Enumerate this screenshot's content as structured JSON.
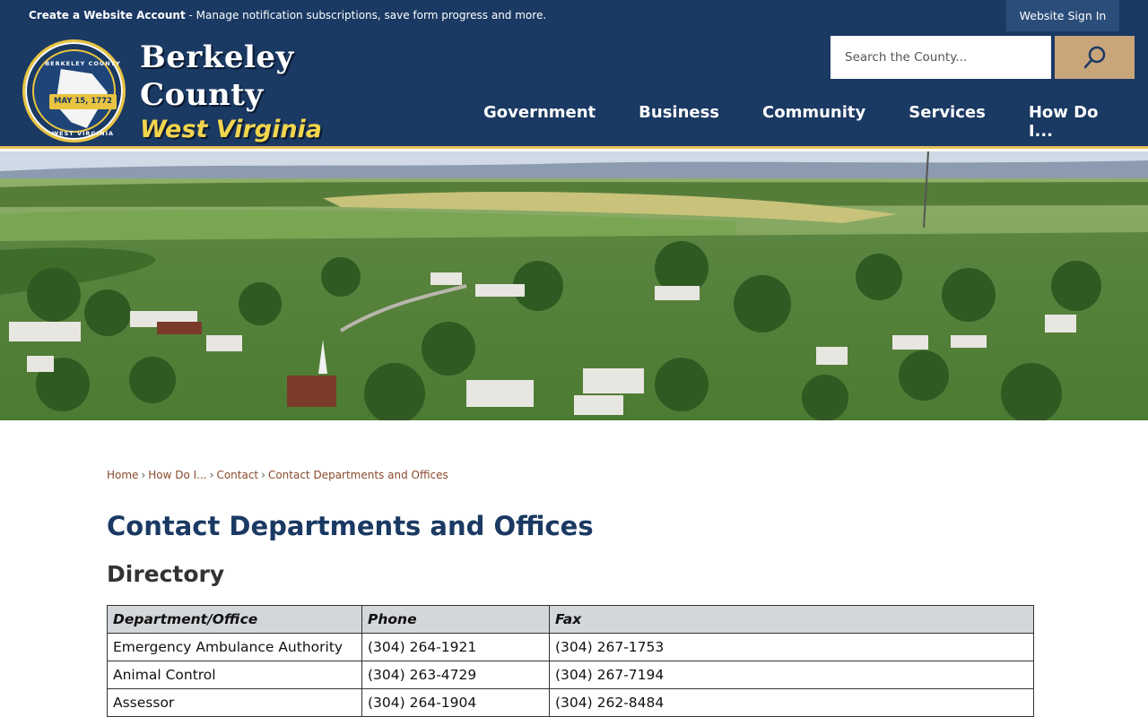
{
  "topbar": {
    "account_link": "Create a Website Account",
    "account_desc": " - Manage notification subscriptions, save form progress and more.",
    "signin": "Website Sign In"
  },
  "header": {
    "seal": {
      "top_text": "BERKELEY COUNTY",
      "date": "MAY 15, 1772",
      "bottom_text": "WEST VIRGINIA"
    },
    "brand_line1": "Berkeley",
    "brand_line2": "County",
    "brand_line3": "West Virginia",
    "search_placeholder": "Search the County...",
    "nav": [
      "Government",
      "Business",
      "Community",
      "Services",
      "How Do I..."
    ]
  },
  "breadcrumb": [
    "Home",
    "How Do I...",
    "Contact",
    "Contact Departments and Offices"
  ],
  "page_title": "Contact Departments and Offices",
  "section_title": "Directory",
  "table": {
    "headers": [
      "Department/Office",
      "Phone",
      "Fax"
    ],
    "rows": [
      [
        "Emergency Ambulance Authority",
        "(304) 264-1921",
        "(304) 267-1753"
      ],
      [
        "Animal Control",
        "(304) 263-4729",
        "(304) 267-7194"
      ],
      [
        "Assessor",
        "(304) 264-1904",
        "(304) 262-8484"
      ]
    ]
  },
  "colors": {
    "navy": "#1a3963",
    "gold": "#e3c25a",
    "search_button": "#c9a57a",
    "link": "#8a4a2c"
  }
}
